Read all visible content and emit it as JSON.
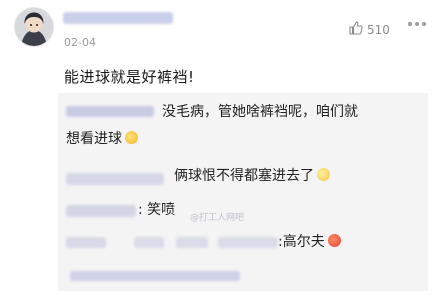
{
  "post": {
    "date": "02-04",
    "likes": "510",
    "comment": "能进球就是好裤裆!"
  },
  "replies": [
    {
      "text": "没毛病，管她啥裤裆呢，咱们就",
      "text2": "想看进球",
      "emoji": "yum-face"
    },
    {
      "text": "俩球恨不得都塞进去了",
      "emoji": "grin-face"
    },
    {
      "text": ": 笑喷"
    },
    {
      "text": ":高尔夫",
      "emoji": "red-face"
    }
  ],
  "watermark": "@打工人网吧",
  "colors": {
    "reply_bg": "#f4f4f5",
    "username_blur": "#c9d0ea"
  }
}
